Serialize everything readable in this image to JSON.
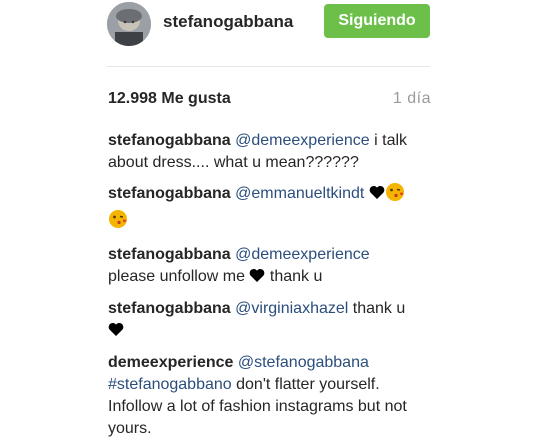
{
  "post": {
    "author": "stefanogabbana",
    "follow_label": "Siguiendo",
    "likes_label": "12.998 Me gusta",
    "time_label": "1 día"
  },
  "comments": [
    {
      "user": "stefanogabbana",
      "mention": "@demeexperience",
      "text": " i talk about dress.... what u mean??????"
    },
    {
      "user": "stefanogabbana",
      "mention": "@emmanueltkindt"
    },
    {
      "user": "stefanogabbana",
      "mention": "@demeexperience",
      "text_before_heart": "please unfollow me ",
      "text_after_heart": " thank u"
    },
    {
      "user": "stefanogabbana",
      "mention": "@virginiaxhazel",
      "text": " thank u"
    },
    {
      "user": "demeexperience",
      "mention": "@stefanogabbana",
      "mention2": "#stefanogabbano",
      "text": " don't flatter yourself. Infollow a lot of fashion instagrams but not yours."
    }
  ],
  "colors": {
    "follow_button": "#6cc04a",
    "mention": "#2b4e7d",
    "time": "#9a9a9a"
  },
  "icons": [
    "black-heart-icon",
    "kiss-face-emoji-icon"
  ]
}
